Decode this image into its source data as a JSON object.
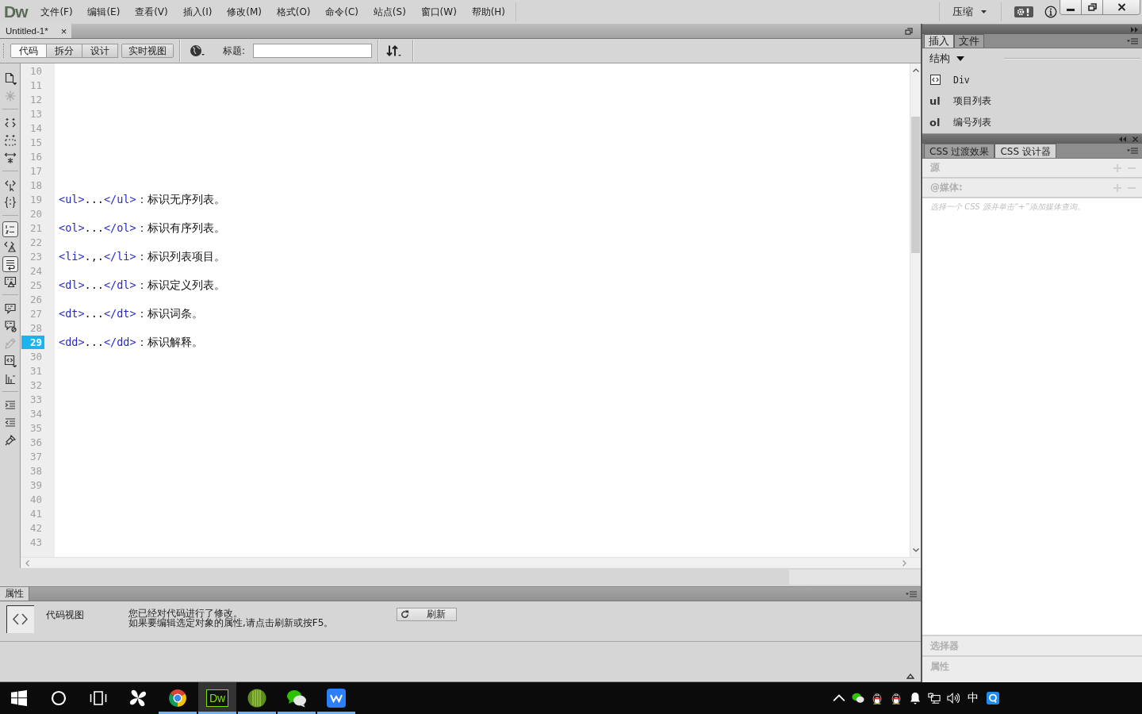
{
  "menubar": {
    "logo": "Dw",
    "menus": [
      "文件(F)",
      "编辑(E)",
      "查看(V)",
      "插入(I)",
      "修改(M)",
      "格式(O)",
      "命令(C)",
      "站点(S)",
      "窗口(W)",
      "帮助(H)"
    ],
    "workspace": "压缩"
  },
  "document_tabs": [
    {
      "label": "Untitled-1*",
      "close": "×",
      "selected": true
    }
  ],
  "view_buttons": [
    {
      "label": "代码",
      "selected": true
    },
    {
      "label": "拆分",
      "selected": false
    },
    {
      "label": "设计",
      "selected": false
    },
    {
      "label": "实时视图",
      "selected": false
    }
  ],
  "title_label": "标题:",
  "code_toolbar": [
    [
      {
        "kind": "document",
        "disabled": false,
        "on": false
      },
      {
        "kind": "starburst",
        "disabled": true,
        "on": false
      }
    ],
    [
      {
        "kind": "collapse_full",
        "disabled": false,
        "on": false
      },
      {
        "kind": "collapse_selection",
        "disabled": false,
        "on": false
      },
      {
        "kind": "expand_all",
        "disabled": false,
        "on": false
      }
    ],
    [
      {
        "kind": "select_parent",
        "disabled": false,
        "on": false
      },
      {
        "kind": "balance_braces",
        "disabled": false,
        "on": false
      }
    ],
    [
      {
        "kind": "line_numbers",
        "disabled": false,
        "on": true
      },
      {
        "kind": "highlight_invalid",
        "disabled": false,
        "on": false
      },
      {
        "kind": "word_wrap",
        "disabled": false,
        "on": true
      },
      {
        "kind": "syntax_error",
        "disabled": false,
        "on": false
      }
    ],
    [
      {
        "kind": "comment",
        "disabled": false,
        "on": false
      },
      {
        "kind": "remove_comment",
        "disabled": false,
        "on": false
      },
      {
        "kind": "wrap_tag",
        "disabled": true,
        "on": false
      },
      {
        "kind": "snippets",
        "disabled": false,
        "on": false
      },
      {
        "kind": "bar_chart",
        "disabled": false,
        "on": false
      }
    ],
    [
      {
        "kind": "indent",
        "disabled": false,
        "on": false
      },
      {
        "kind": "outdent",
        "disabled": false,
        "on": false
      },
      {
        "kind": "format",
        "disabled": false,
        "on": false
      }
    ]
  ],
  "editor": {
    "lines": [
      {
        "number": "10",
        "current": false
      },
      {
        "number": "11",
        "current": false
      },
      {
        "number": "12",
        "current": false
      },
      {
        "number": "13",
        "current": false
      },
      {
        "number": "14",
        "current": false
      },
      {
        "number": "15",
        "current": false
      },
      {
        "number": "16",
        "current": false
      },
      {
        "number": "17",
        "current": false
      },
      {
        "number": "18",
        "current": false
      },
      {
        "number": "19",
        "current": false,
        "segments": [
          {
            "kind": "tag",
            "text": "<ul>"
          },
          {
            "kind": "text",
            "text": "..."
          },
          {
            "kind": "tag",
            "text": "</ul>"
          },
          {
            "kind": "text",
            "text": "：标识无序列表。"
          }
        ]
      },
      {
        "number": "20",
        "current": false
      },
      {
        "number": "21",
        "current": false,
        "segments": [
          {
            "kind": "tag",
            "text": "<ol>"
          },
          {
            "kind": "text",
            "text": "..."
          },
          {
            "kind": "tag",
            "text": "</ol>"
          },
          {
            "kind": "text",
            "text": "：标识有序列表。"
          }
        ]
      },
      {
        "number": "22",
        "current": false
      },
      {
        "number": "23",
        "current": false,
        "segments": [
          {
            "kind": "tag",
            "text": "<li>"
          },
          {
            "kind": "text",
            "text": ".,."
          },
          {
            "kind": "tag",
            "text": "</li>"
          },
          {
            "kind": "text",
            "text": "：标识列表项目。"
          }
        ]
      },
      {
        "number": "24",
        "current": false
      },
      {
        "number": "25",
        "current": false,
        "segments": [
          {
            "kind": "tag",
            "text": "<dl>"
          },
          {
            "kind": "text",
            "text": "..."
          },
          {
            "kind": "tag",
            "text": "</dl>"
          },
          {
            "kind": "text",
            "text": "：标识定义列表。"
          }
        ]
      },
      {
        "number": "26",
        "current": false
      },
      {
        "number": "27",
        "current": false,
        "segments": [
          {
            "kind": "tag",
            "text": "<dt>"
          },
          {
            "kind": "text",
            "text": "..."
          },
          {
            "kind": "tag",
            "text": "</dt>"
          },
          {
            "kind": "text",
            "text": "：标识词条。"
          }
        ]
      },
      {
        "number": "28",
        "current": false
      },
      {
        "number": "29",
        "current": true,
        "segments": [
          {
            "kind": "tag",
            "text": "<dd>"
          },
          {
            "kind": "text",
            "text": "..."
          },
          {
            "kind": "tag",
            "text": "</dd>"
          },
          {
            "kind": "text",
            "text": "：标识解释。"
          }
        ]
      },
      {
        "number": "30",
        "current": false
      },
      {
        "number": "31",
        "current": false
      },
      {
        "number": "32",
        "current": false
      },
      {
        "number": "33",
        "current": false
      },
      {
        "number": "34",
        "current": false
      },
      {
        "number": "35",
        "current": false
      },
      {
        "number": "36",
        "current": false
      },
      {
        "number": "37",
        "current": false
      },
      {
        "number": "38",
        "current": false
      },
      {
        "number": "39",
        "current": false
      },
      {
        "number": "40",
        "current": false
      },
      {
        "number": "41",
        "current": false
      },
      {
        "number": "42",
        "current": false
      },
      {
        "number": "43",
        "current": false
      }
    ]
  },
  "properties": {
    "tab": "属性",
    "mode": "代码视图",
    "message": [
      "您已经对代码进行了修改。",
      "如果要编辑选定对象的属性,请点击刷新或按F5。"
    ],
    "refresh": "刷新"
  },
  "insert_panel": {
    "tabs": [
      {
        "label": "插入",
        "selected": true
      },
      {
        "label": "文件",
        "selected": false
      }
    ],
    "category": "结构",
    "items": [
      {
        "kind": "icon",
        "label": "Div"
      },
      {
        "kind": "abbr",
        "abbr": "ul",
        "label": "项目列表"
      },
      {
        "kind": "abbr",
        "abbr": "ol",
        "label": "编号列表"
      }
    ]
  },
  "css_panel": {
    "tabs": [
      {
        "label": "CSS 过渡效果",
        "selected": false
      },
      {
        "label": "CSS 设计器",
        "selected": true
      }
    ],
    "sections": [
      {
        "title": "源"
      },
      {
        "title": "@媒体:",
        "hint": "选择一个 CSS 源并单击“+”添加媒体查询。"
      }
    ],
    "bottom_sections": [
      "选择器",
      "属性"
    ]
  },
  "taskbar": {
    "apps": [
      {
        "kind": "start",
        "running": false,
        "selected": false
      },
      {
        "kind": "search",
        "running": false,
        "selected": false
      },
      {
        "kind": "task_view",
        "running": false,
        "selected": false
      },
      {
        "kind": "pinwheel",
        "running": false,
        "selected": false
      },
      {
        "kind": "browser",
        "running": true,
        "selected": false
      },
      {
        "kind": "dw",
        "label": "Dw",
        "running": true,
        "selected": true
      },
      {
        "kind": "leaf",
        "running": true,
        "selected": false
      },
      {
        "kind": "chat",
        "running": true,
        "selected": false
      },
      {
        "kind": "zigzag",
        "running": true,
        "selected": false
      }
    ],
    "tray": [
      {
        "kind": "chevron"
      },
      {
        "kind": "chat"
      },
      {
        "kind": "penguin"
      },
      {
        "kind": "penguin"
      },
      {
        "kind": "bell"
      },
      {
        "kind": "network"
      },
      {
        "kind": "volume"
      },
      {
        "kind": "ime",
        "label": "中"
      },
      {
        "kind": "ring_tile"
      }
    ]
  }
}
